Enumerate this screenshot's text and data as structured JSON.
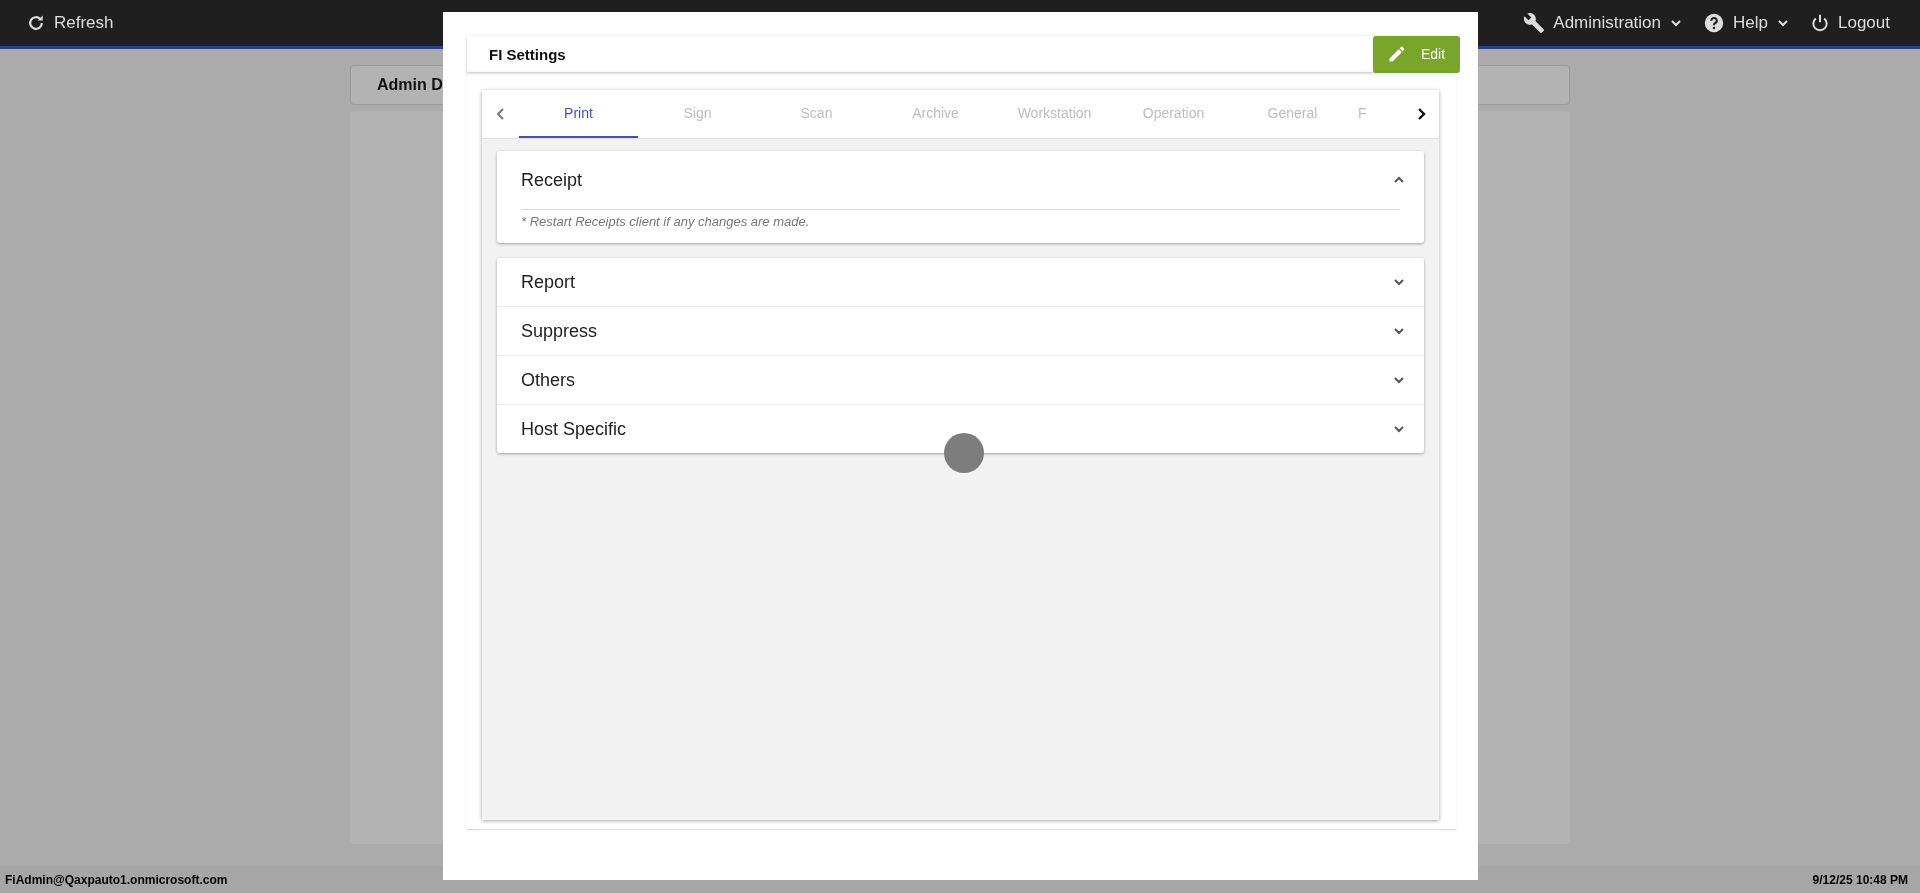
{
  "top_bar": {
    "refresh": "Refresh",
    "menus": [
      {
        "label": "Administration",
        "kind": "wrench"
      },
      {
        "label": "Help",
        "kind": "help"
      }
    ],
    "logout": "Logout"
  },
  "background_page": {
    "title": "Admin D"
  },
  "dialog": {
    "title": "FI Settings",
    "edit_button": "Edit",
    "tabs": [
      {
        "label": "Print",
        "selected": true
      },
      {
        "label": "Sign",
        "selected": false
      },
      {
        "label": "Scan",
        "selected": false
      },
      {
        "label": "Archive",
        "selected": false
      },
      {
        "label": "Workstation",
        "selected": false
      },
      {
        "label": "Operation",
        "selected": false
      },
      {
        "label": "General",
        "selected": false
      },
      {
        "label": "F",
        "selected": false
      }
    ],
    "sections": [
      {
        "title": "Receipt",
        "expanded": true,
        "note": "* Restart Receipts client if any changes are made."
      },
      {
        "title": "Report",
        "expanded": false
      },
      {
        "title": "Suppress",
        "expanded": false
      },
      {
        "title": "Others",
        "expanded": false
      },
      {
        "title": "Host Specific",
        "expanded": false
      }
    ],
    "loading": true
  },
  "status_bar": {
    "user": "FiAdmin@Qaxpauto1.onmicrosoft.com",
    "datetime": "9/12/25 10:48 PM"
  }
}
